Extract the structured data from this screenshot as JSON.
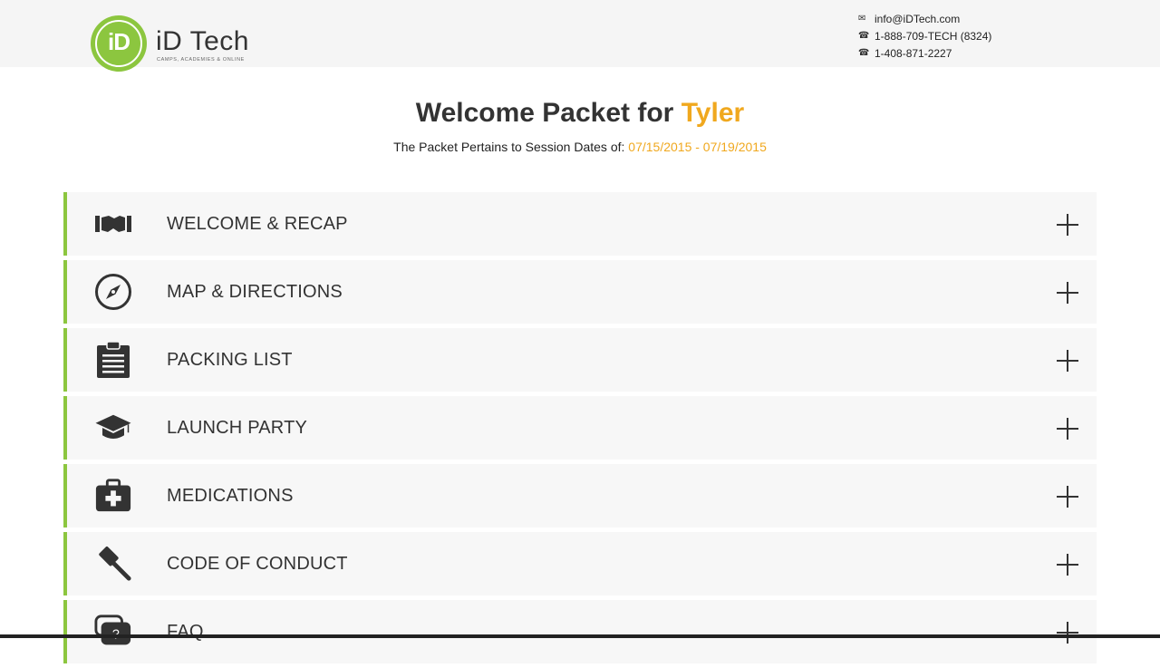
{
  "brand": {
    "logo_mark": "iD",
    "name": "iD Tech",
    "tagline": "CAMPS, ACADEMIES & ONLINE",
    "accent_color": "#8cc63f",
    "highlight_color": "#f0a81e"
  },
  "contact": {
    "email": "info@iDTech.com",
    "phone1": "1-888-709-TECH (8324)",
    "phone2": "1-408-871-2227",
    "email_icon": "envelope-icon",
    "phone_icon": "phone-icon"
  },
  "header": {
    "title_prefix": "Welcome Packet for",
    "student_name": "Tyler",
    "dates_prefix": "The Packet Pertains to Session Dates of:",
    "dates": "07/15/2015 - 07/19/2015"
  },
  "sections": [
    {
      "label": "WELCOME & RECAP",
      "icon": "handshake-icon"
    },
    {
      "label": "MAP & DIRECTIONS",
      "icon": "compass-icon"
    },
    {
      "label": "PACKING LIST",
      "icon": "clipboard-icon"
    },
    {
      "label": "LAUNCH PARTY",
      "icon": "graduation-cap-icon"
    },
    {
      "label": "MEDICATIONS",
      "icon": "medical-kit-icon"
    },
    {
      "label": "CODE OF CONDUCT",
      "icon": "gavel-icon"
    },
    {
      "label": "FAQ",
      "icon": "question-chat-icon"
    }
  ]
}
